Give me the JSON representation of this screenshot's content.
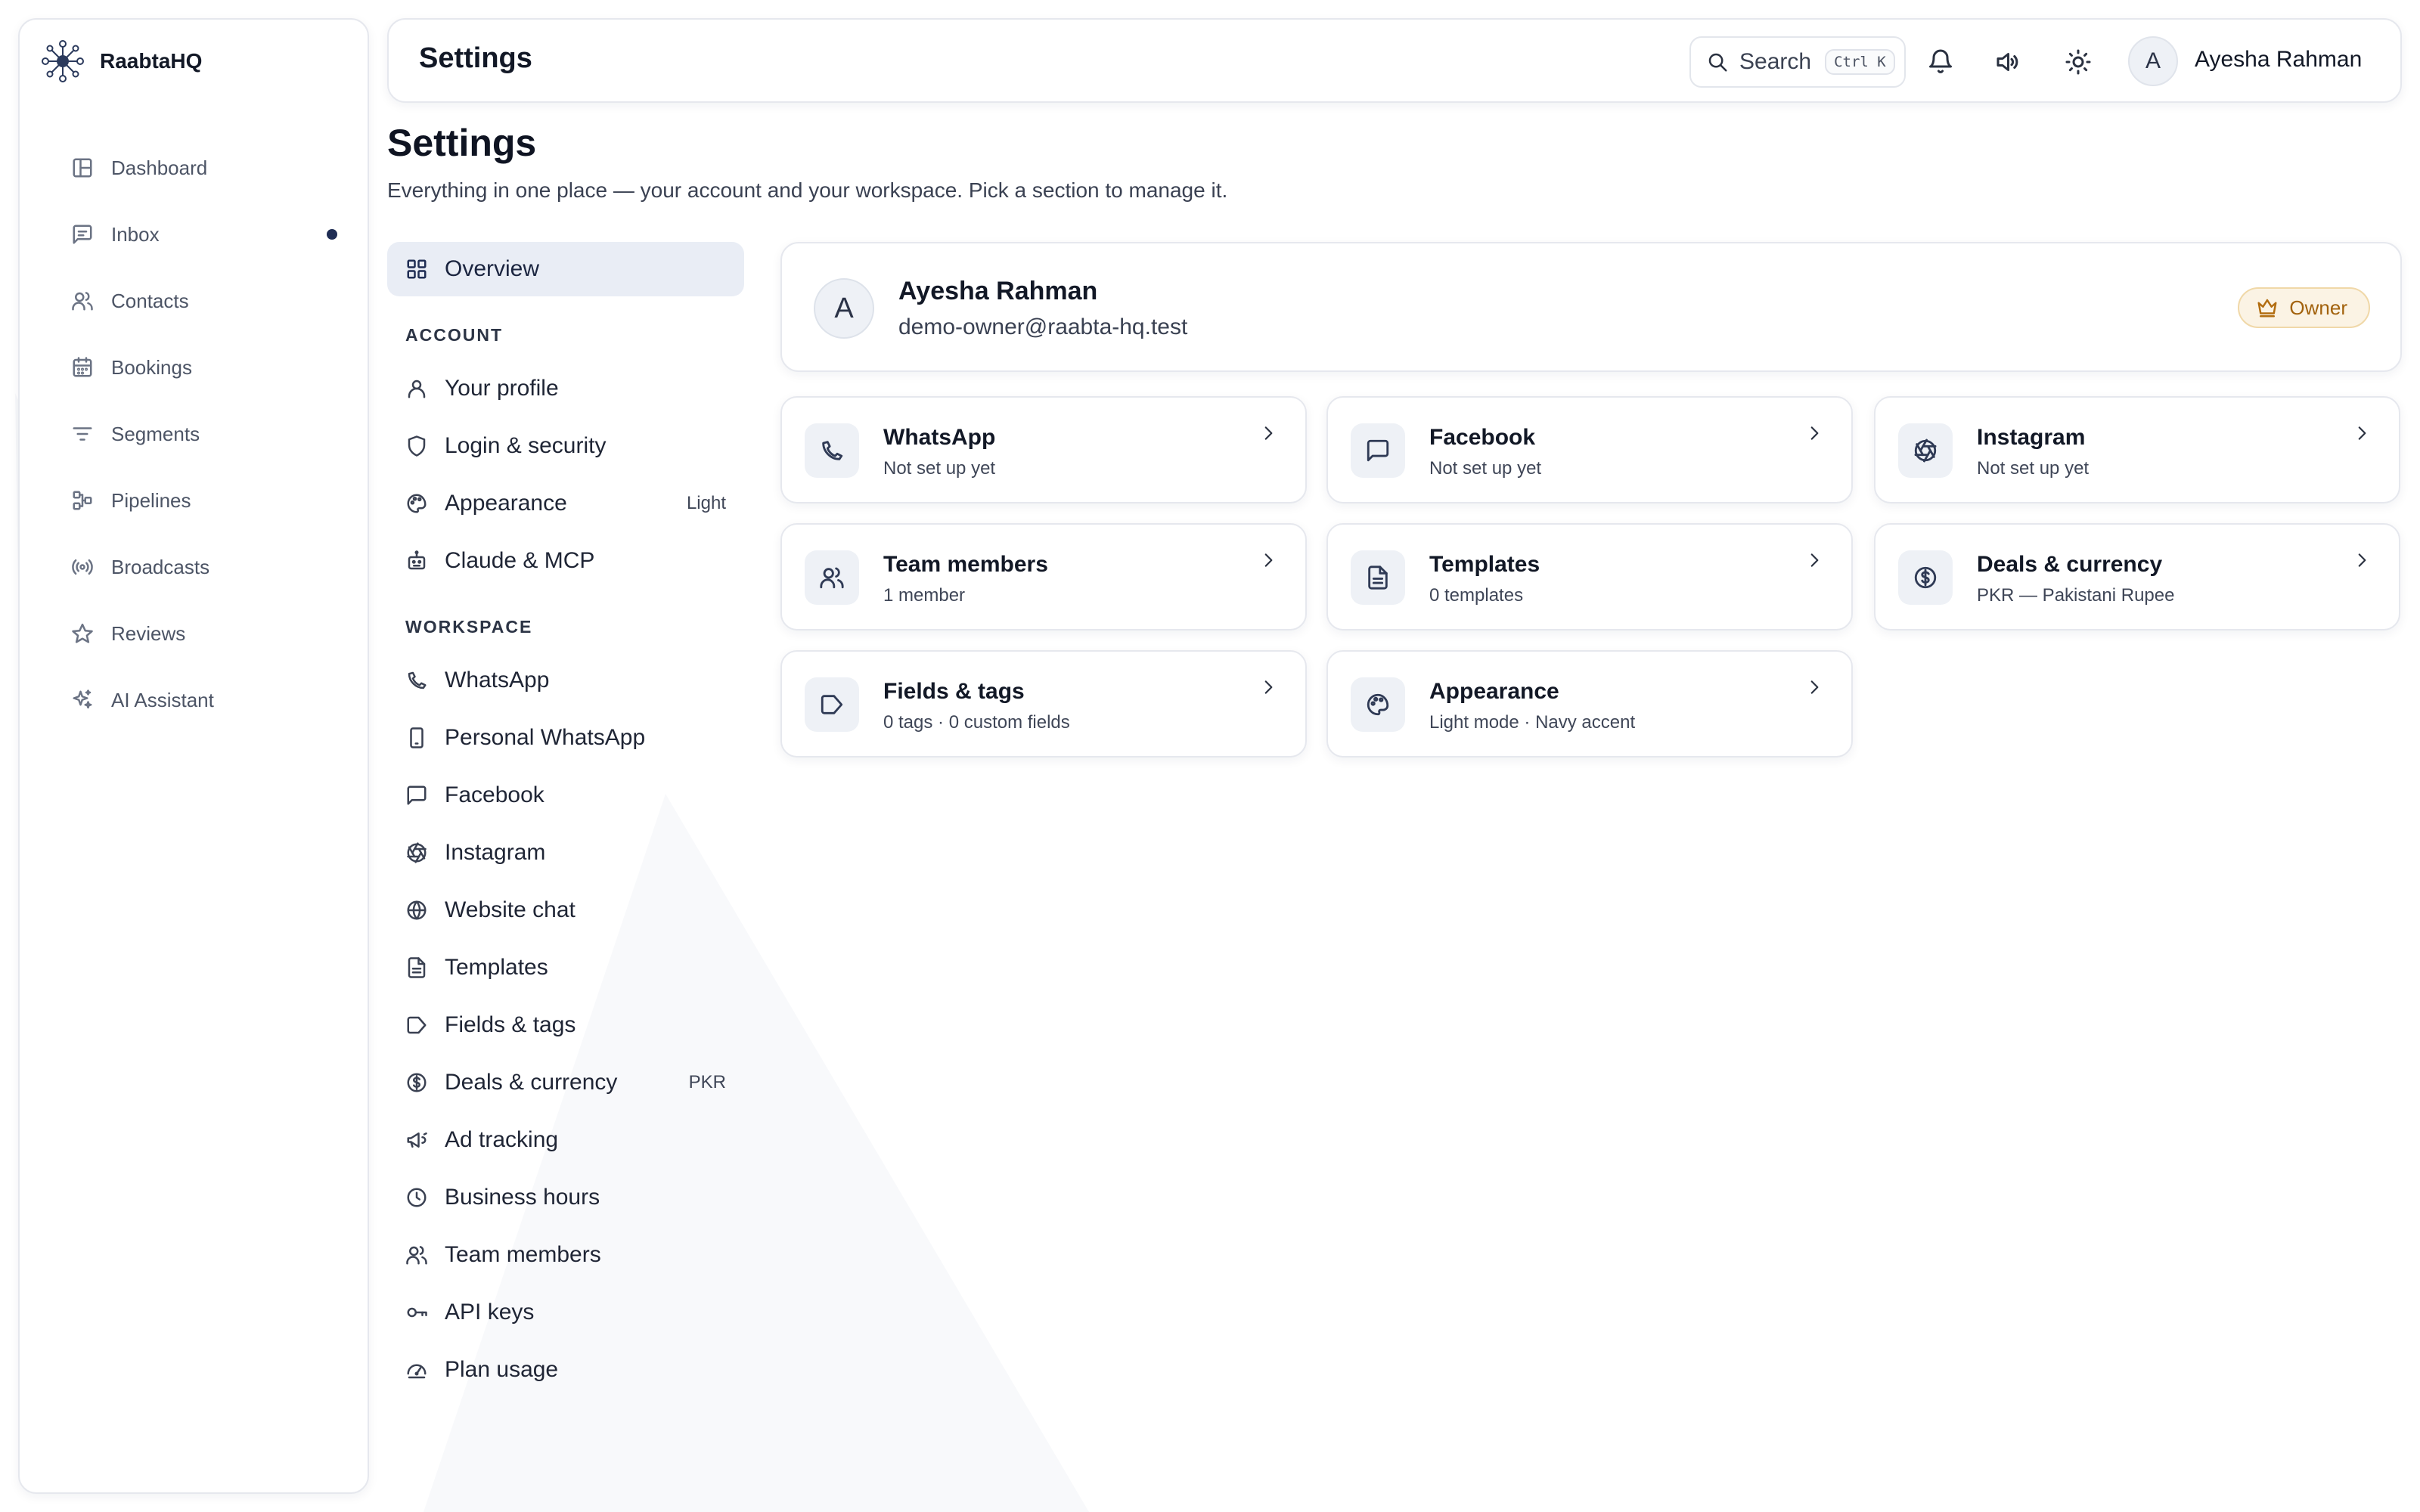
{
  "app": {
    "brand": "RaabtaHQ"
  },
  "sidebar": {
    "items": [
      {
        "label": "Dashboard",
        "icon": "dashboard-icon"
      },
      {
        "label": "Inbox",
        "icon": "inbox-icon",
        "unread": true
      },
      {
        "label": "Contacts",
        "icon": "contacts-icon"
      },
      {
        "label": "Bookings",
        "icon": "calendar-icon"
      },
      {
        "label": "Segments",
        "icon": "filter-icon"
      },
      {
        "label": "Pipelines",
        "icon": "pipeline-icon"
      },
      {
        "label": "Broadcasts",
        "icon": "broadcast-icon"
      },
      {
        "label": "Reviews",
        "icon": "star-icon"
      },
      {
        "label": "AI Assistant",
        "icon": "sparkle-icon"
      }
    ],
    "accent": "#1f2d54"
  },
  "topbar": {
    "title": "Settings",
    "search_label": "Search",
    "search_shortcut": "Ctrl K",
    "user_initial": "A",
    "user_name": "Ayesha Rahman"
  },
  "page": {
    "title": "Settings",
    "subtitle": "Everything in one place — your account and your workspace. Pick a section to manage it."
  },
  "settings_nav": {
    "overview": "Overview",
    "account_heading": "ACCOUNT",
    "account_items": [
      {
        "label": "Your profile",
        "icon": "user-icon"
      },
      {
        "label": "Login & security",
        "icon": "shield-icon"
      },
      {
        "label": "Appearance",
        "icon": "palette-icon",
        "hint": "Light"
      },
      {
        "label": "Claude & MCP",
        "icon": "bot-icon"
      }
    ],
    "workspace_heading": "WORKSPACE",
    "workspace_items": [
      {
        "label": "WhatsApp",
        "icon": "whatsapp-icon"
      },
      {
        "label": "Personal WhatsApp",
        "icon": "phone-icon"
      },
      {
        "label": "Facebook",
        "icon": "message-square-icon"
      },
      {
        "label": "Instagram",
        "icon": "aperture-icon"
      },
      {
        "label": "Website chat",
        "icon": "globe-icon"
      },
      {
        "label": "Templates",
        "icon": "file-text-icon"
      },
      {
        "label": "Fields & tags",
        "icon": "tag-icon"
      },
      {
        "label": "Deals & currency",
        "icon": "currency-icon",
        "hint": "PKR"
      },
      {
        "label": "Ad tracking",
        "icon": "megaphone-icon"
      },
      {
        "label": "Business hours",
        "icon": "clock-icon"
      },
      {
        "label": "Team members",
        "icon": "team-icon"
      },
      {
        "label": "API keys",
        "icon": "key-icon"
      },
      {
        "label": "Plan usage",
        "icon": "gauge-icon"
      }
    ]
  },
  "profile": {
    "initial": "A",
    "name": "Ayesha Rahman",
    "email": "demo-owner@raabta-hq.test",
    "role": "Owner"
  },
  "cards": [
    {
      "title": "WhatsApp",
      "subtitle": "Not set up yet",
      "icon": "whatsapp-icon"
    },
    {
      "title": "Facebook",
      "subtitle": "Not set up yet",
      "icon": "message-square-icon"
    },
    {
      "title": "Instagram",
      "subtitle": "Not set up yet",
      "icon": "aperture-icon"
    },
    {
      "title": "Team members",
      "subtitle": "1 member",
      "icon": "team-icon"
    },
    {
      "title": "Templates",
      "subtitle": "0 templates",
      "icon": "file-text-icon"
    },
    {
      "title": "Deals & currency",
      "subtitle": "PKR — Pakistani Rupee",
      "icon": "currency-icon"
    },
    {
      "title": "Fields & tags",
      "subtitle": "0 tags · 0 custom fields",
      "icon": "tag-icon"
    },
    {
      "title": "Appearance",
      "subtitle": "Light mode · Navy accent",
      "icon": "palette-icon"
    }
  ]
}
